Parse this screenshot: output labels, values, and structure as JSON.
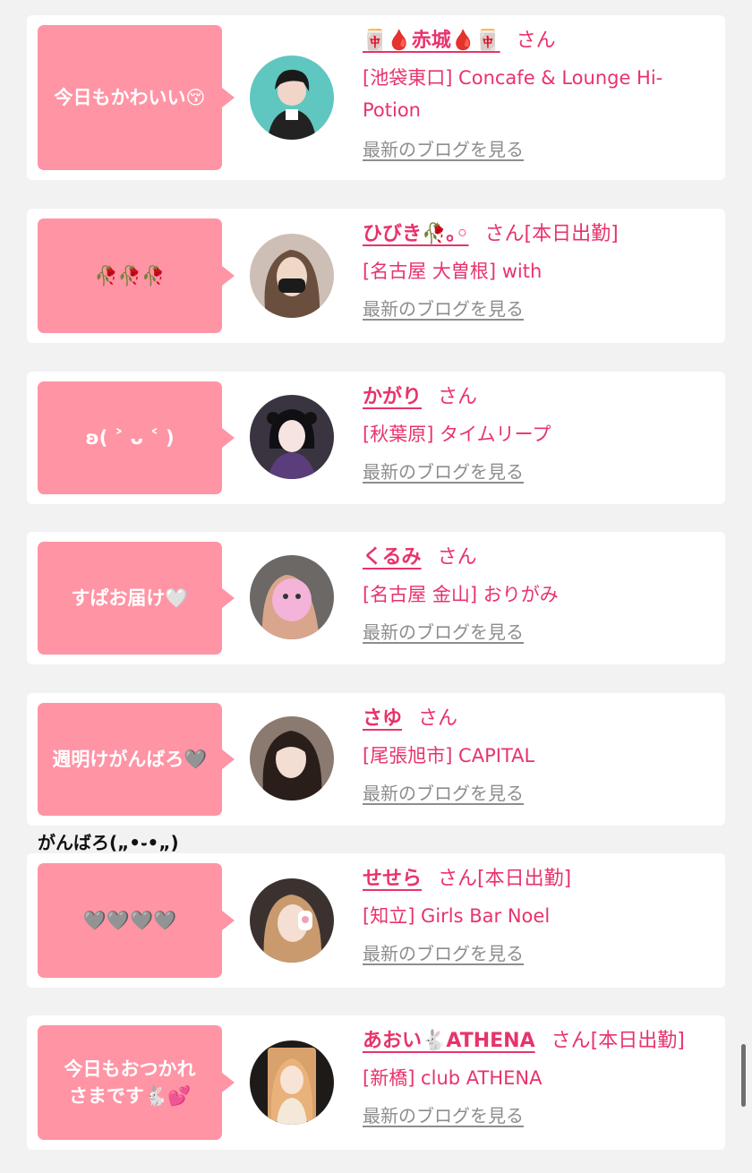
{
  "entries": [
    {
      "bubble": "今日もかわいい😚",
      "name": "🀄🩸赤城🩸🀄",
      "san": "さん",
      "status": "",
      "shop": "[池袋東口] Concafe & Lounge Hi-Potion",
      "blog": "最新のブログを見る"
    },
    {
      "bubble": "🥀🥀🥀",
      "name": "ひびき🥀｡◦",
      "san": "さん",
      "status": "[本日出勤]",
      "shop": "[名古屋 大曽根] with",
      "blog": "最新のブログを見る"
    },
    {
      "bubble": "ʚ( ˃ ᴗ ˂ )",
      "name": "かがり",
      "san": "さん",
      "status": "",
      "shop": "[秋葉原] タイムリープ",
      "blog": "最新のブログを見る"
    },
    {
      "bubble": "すぱお届け🤍",
      "name": "くるみ",
      "san": "さん",
      "status": "",
      "shop": "[名古屋 金山] おりがみ",
      "blog": "最新のブログを見る"
    },
    {
      "bubble": "週明けがんばろ🩶",
      "name": "さゆ",
      "san": "さん",
      "status": "",
      "shop": "[尾張旭市] CAPITAL",
      "blog": "最新のブログを見る"
    },
    {
      "bubble": "🩶🩶🩶🩶",
      "name": "せせら",
      "san": "さん",
      "status": "[本日出勤]",
      "shop": "[知立] Girls Bar Noel",
      "blog": "最新のブログを見る"
    },
    {
      "bubble": "今日もおつかれさまです🐇💕",
      "name": "あおい🐇ATHENA",
      "san": "さん",
      "status": "[本日出勤]",
      "shop": "[新橋] club ATHENA",
      "blog": "最新のブログを見る"
    }
  ],
  "comment": "がんばろ(„•֊•„)",
  "colors": {
    "accent": "#e8336b",
    "bubble": "#ff94a5",
    "link_gray": "#8d8d8d",
    "background": "#f2f2f2"
  }
}
